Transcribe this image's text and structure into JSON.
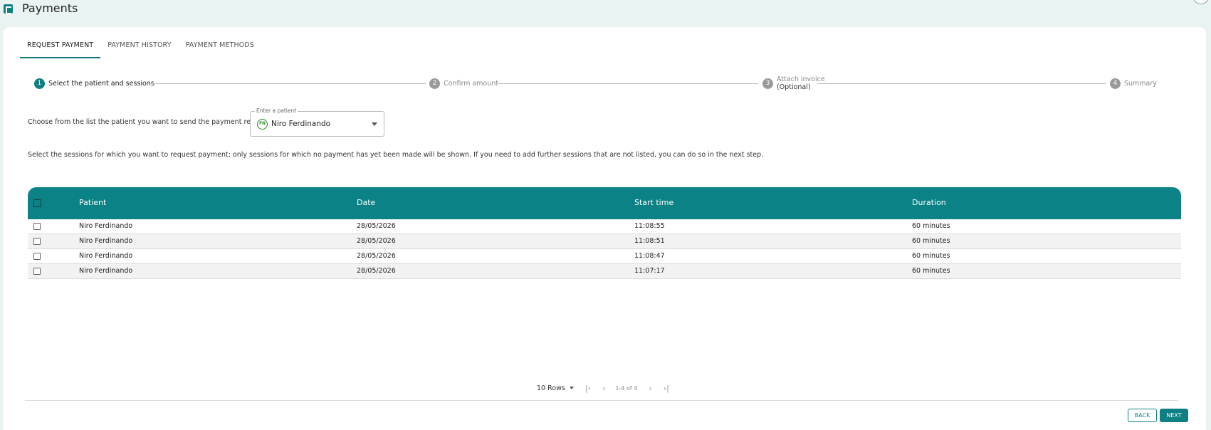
{
  "header": {
    "title": "Payments"
  },
  "tabs": [
    {
      "label": "REQUEST PAYMENT",
      "active": true
    },
    {
      "label": "PAYMENT HISTORY",
      "active": false
    },
    {
      "label": "PAYMENT METHODS",
      "active": false
    }
  ],
  "stepper": {
    "steps": [
      {
        "number": "1",
        "label": "Select the patient and sessions",
        "sub": "",
        "active": true
      },
      {
        "number": "2",
        "label": "Confirm amount",
        "sub": "",
        "active": false
      },
      {
        "number": "3",
        "label": "Attach invoice",
        "sub": "(Optional)",
        "active": false
      },
      {
        "number": "4",
        "label": "Summary",
        "sub": "",
        "active": false
      }
    ]
  },
  "patient_picker": {
    "instruction": "Choose from the list the patient you want to send the payment request to:",
    "legend": "Enter a patient",
    "avatar_initials": "FN",
    "value": "Niro Ferdinando"
  },
  "sessions_instruction": "Select the sessions for which you want to request payment: only sessions for which no payment has yet been made will be shown. If you need to add further sessions that are not listed, you can do so in the next step.",
  "table": {
    "columns": [
      "Patient",
      "Date",
      "Start time",
      "Duration"
    ],
    "rows": [
      {
        "patient": "Niro Ferdinando",
        "date": "28/05/2026",
        "start": "11:08:55",
        "duration": "60 minutes"
      },
      {
        "patient": "Niro Ferdinando",
        "date": "28/05/2026",
        "start": "11:08:51",
        "duration": "60 minutes"
      },
      {
        "patient": "Niro Ferdinando",
        "date": "28/05/2026",
        "start": "11:08:47",
        "duration": "60 minutes"
      },
      {
        "patient": "Niro Ferdinando",
        "date": "28/05/2026",
        "start": "11:07:17",
        "duration": "60 minutes"
      }
    ]
  },
  "pagination": {
    "rows_label": "10 Rows",
    "range": "1-4 of 4",
    "first_icon": "first-page-icon",
    "prev_icon": "prev-page-icon",
    "next_icon": "next-page-icon",
    "last_icon": "last-page-icon"
  },
  "footer": {
    "back_label": "BACK",
    "next_label": "NEXT"
  },
  "colors": {
    "accent": "#0e7f83",
    "page_bg": "#e9f3f1"
  }
}
